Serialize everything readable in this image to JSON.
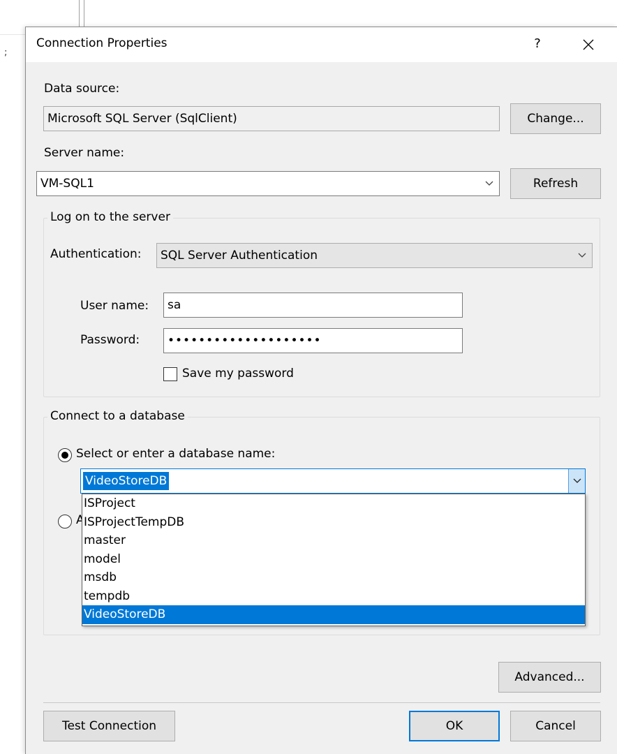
{
  "dialog": {
    "title": "Connection Properties",
    "help_label": "?"
  },
  "background": {
    "left_glyph": ";"
  },
  "data_source": {
    "label": "Data source:",
    "value": "Microsoft SQL Server (SqlClient)",
    "change_button": "Change..."
  },
  "server": {
    "label": "Server name:",
    "value": "VM-SQL1",
    "refresh_button": "Refresh"
  },
  "logon": {
    "group_label": "Log on to the server",
    "auth_label": "Authentication:",
    "auth_value": "SQL Server Authentication",
    "username_label": "User name:",
    "username_value": "sa",
    "password_label": "Password:",
    "password_value": "••••••••••••••••••••",
    "save_password_label": "Save my password",
    "save_password_checked": false
  },
  "database": {
    "group_label": "Connect to a database",
    "select_option_label": "Select or enter a database name:",
    "select_option_checked": true,
    "attach_option_checked": false,
    "attach_option_visible_text": "A",
    "current_value": "VideoStoreDB",
    "options": [
      "ISProject",
      "ISProjectTempDB",
      "master",
      "model",
      "msdb",
      "tempdb",
      "VideoStoreDB"
    ],
    "selected_option": "VideoStoreDB"
  },
  "footer": {
    "advanced_button": "Advanced...",
    "test_connection_button": "Test Connection",
    "ok_button": "OK",
    "cancel_button": "Cancel"
  },
  "colors": {
    "accent": "#0078d7",
    "dialog_bg": "#f0f0f0",
    "button_bg": "#e1e1e1"
  }
}
